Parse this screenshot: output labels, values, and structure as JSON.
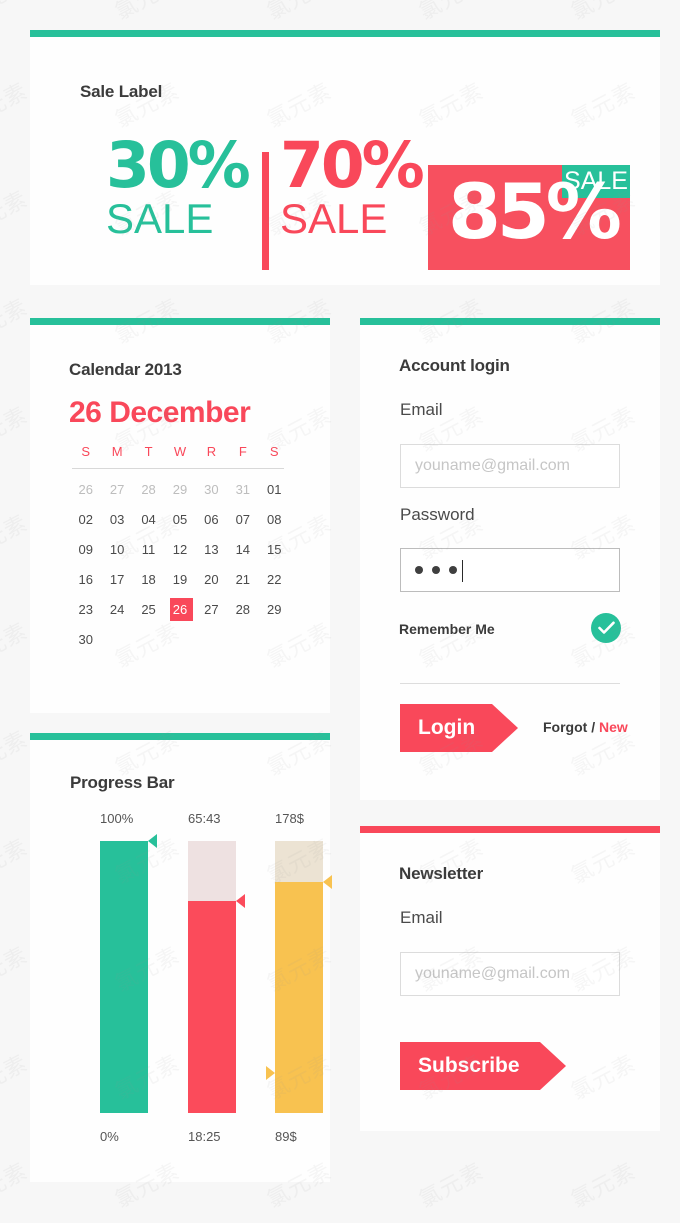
{
  "colors": {
    "accent_green": "#27c09a",
    "accent_red": "#f9485a",
    "sale_block_red": "#f7505f",
    "bar_green": "#27c09a",
    "bar_red": "#fb4b5b",
    "bar_yellow": "#f8c250",
    "bar_track_pink": "#eee1e1",
    "bar_track_cream": "#ece3d3",
    "page_background": "#f7f7f7",
    "card_background": "#fefefe"
  },
  "sale_section": {
    "heading": "Sale Label",
    "items": [
      {
        "percent": "30%",
        "label": "SALE",
        "style": "green-text"
      },
      {
        "percent": "70%",
        "label": "SALE",
        "style": "red-text"
      },
      {
        "percent": "85%",
        "badge": "SALE",
        "style": "red-block"
      }
    ]
  },
  "calendar": {
    "title": "Calendar 2013",
    "selected_date": "26 December",
    "selected_day": "26",
    "day_headers": [
      "S",
      "M",
      "T",
      "W",
      "R",
      "F",
      "S"
    ],
    "weeks": [
      [
        {
          "d": "26",
          "muted": true
        },
        {
          "d": "27",
          "muted": true
        },
        {
          "d": "28",
          "muted": true
        },
        {
          "d": "29",
          "muted": true
        },
        {
          "d": "30",
          "muted": true
        },
        {
          "d": "31",
          "muted": true
        },
        {
          "d": "01"
        }
      ],
      [
        {
          "d": "02"
        },
        {
          "d": "03"
        },
        {
          "d": "04"
        },
        {
          "d": "05"
        },
        {
          "d": "06"
        },
        {
          "d": "07"
        },
        {
          "d": "08"
        }
      ],
      [
        {
          "d": "09"
        },
        {
          "d": "10"
        },
        {
          "d": "11"
        },
        {
          "d": "12"
        },
        {
          "d": "13"
        },
        {
          "d": "14"
        },
        {
          "d": "15"
        }
      ],
      [
        {
          "d": "16"
        },
        {
          "d": "17"
        },
        {
          "d": "18"
        },
        {
          "d": "19"
        },
        {
          "d": "20"
        },
        {
          "d": "21"
        },
        {
          "d": "22"
        }
      ],
      [
        {
          "d": "23"
        },
        {
          "d": "24"
        },
        {
          "d": "25"
        },
        {
          "d": "26",
          "active": true
        },
        {
          "d": "27"
        },
        {
          "d": "28"
        },
        {
          "d": "29"
        }
      ],
      [
        {
          "d": "30"
        },
        {
          "d": "",
          "empty": true
        },
        {
          "d": "",
          "empty": true
        },
        {
          "d": "",
          "empty": true
        },
        {
          "d": "",
          "empty": true
        },
        {
          "d": "",
          "empty": true
        },
        {
          "d": "",
          "empty": true
        }
      ]
    ]
  },
  "progress": {
    "title": "Progress Bar",
    "bars": [
      {
        "top_label": "100%",
        "bottom_label": "0%",
        "fill_percent": 100,
        "marker": "top",
        "color": "#27c09a"
      },
      {
        "top_label": "65:43",
        "bottom_label": "18:25",
        "fill_percent": 78,
        "marker": "fill-top",
        "color": "#fb4b5b"
      },
      {
        "top_label": "178$",
        "bottom_label": "89$",
        "fill_percent": 85,
        "marker": "both",
        "color": "#f8c250"
      }
    ]
  },
  "login": {
    "title": "Account login",
    "email_label": "Email",
    "email_placeholder": "youname@gmail.com",
    "email_value": "",
    "password_label": "Password",
    "password_masked_chars": 3,
    "remember_label": "Remember Me",
    "remember_checked": true,
    "check_icon": "check-icon",
    "login_button": "Login",
    "forgot_text": "Forgot /",
    "new_text": "New"
  },
  "newsletter": {
    "title": "Newsletter",
    "email_label": "Email",
    "email_placeholder": "youname@gmail.com",
    "email_value": "",
    "subscribe_button": "Subscribe"
  }
}
